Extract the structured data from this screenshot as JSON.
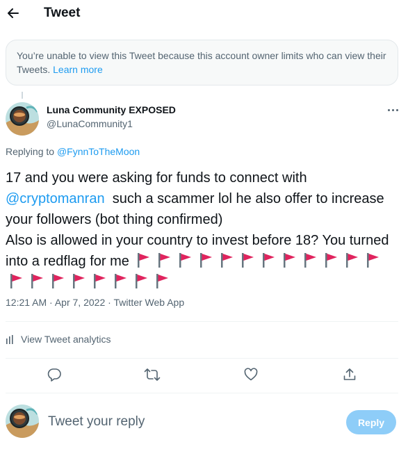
{
  "header": {
    "title": "Tweet",
    "back_icon": "arrow-left-icon"
  },
  "notice": {
    "text": "You’re unable to view this Tweet because this account owner limits who can view their Tweets.",
    "link": "Learn more"
  },
  "tweet": {
    "author_name": "Luna Community EXPOSED",
    "author_handle": "@LunaCommunity1",
    "replying_prefix": "Replying to",
    "replying_to": "@FynnToTheMoon",
    "text_part1": "17 and you were asking for funds to connect with",
    "mention": "@cryptomanran",
    "text_part2": "such a scammer lol he also offer to increase your followers (bot thing confirmed)",
    "text_part3": "Also is allowed in your country to invest before 18? You turned into a redflag for me",
    "flag_count": 20,
    "flag_color": "#e0245e",
    "time": "12:21 AM",
    "date": "Apr 7, 2022",
    "source": "Twitter Web App",
    "separator": "·"
  },
  "analytics": {
    "label": "View Tweet analytics"
  },
  "actions": [
    "reply-icon",
    "retweet-icon",
    "like-icon",
    "share-icon"
  ],
  "reply_box": {
    "placeholder": "Tweet your reply",
    "button_label": "Reply"
  },
  "colors": {
    "accent": "#1d9bf0",
    "muted": "#536471",
    "reply_button_disabled": "#8ecdf8"
  }
}
